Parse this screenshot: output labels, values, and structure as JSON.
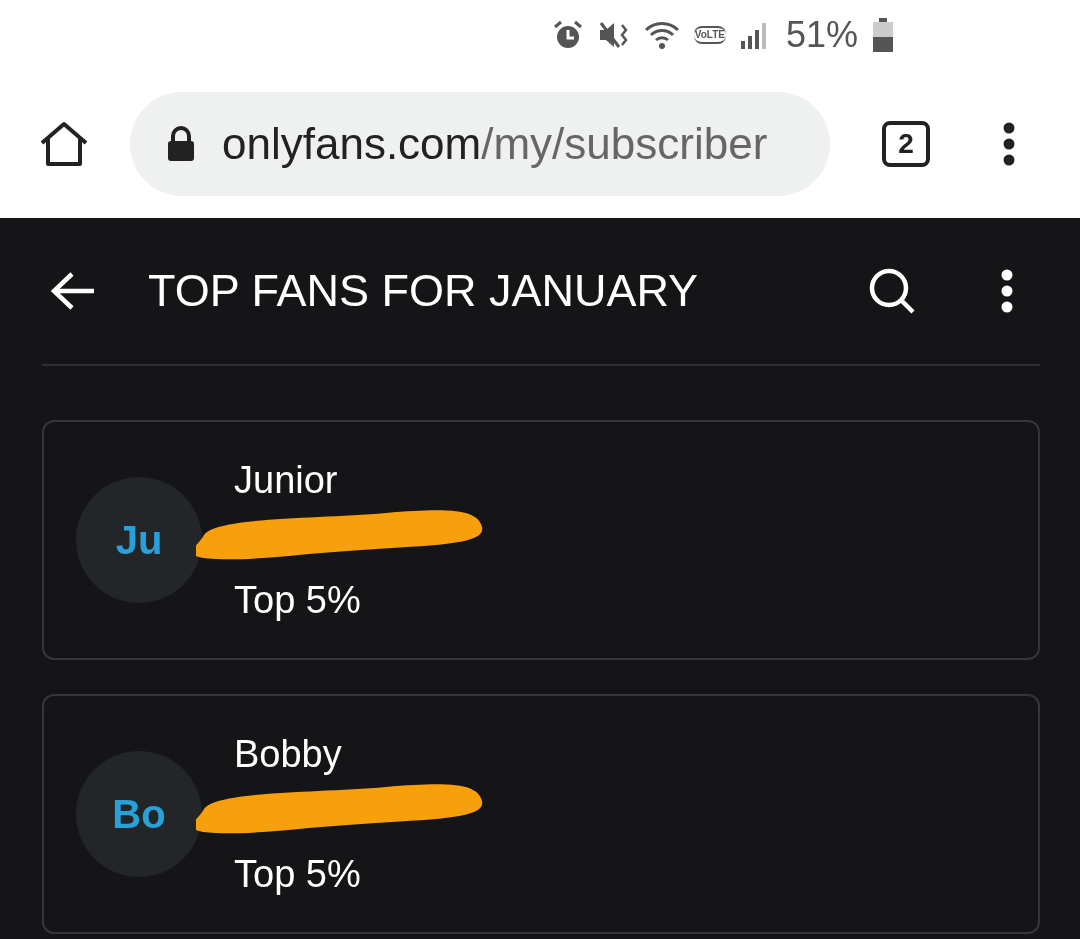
{
  "status_bar": {
    "volte_label": "VoLTE",
    "battery_text": "51%"
  },
  "browser": {
    "url_host": "onlyfans.com",
    "url_path": "/my/subscriber",
    "tab_count": "2"
  },
  "header": {
    "title": "TOP FANS FOR JANUARY"
  },
  "fans": [
    {
      "initials": "Ju",
      "name": "Junior",
      "rank": "Top 5%",
      "redacted": true
    },
    {
      "initials": "Bo",
      "name": "Bobby",
      "rank": "Top 5%",
      "redacted": true
    }
  ]
}
